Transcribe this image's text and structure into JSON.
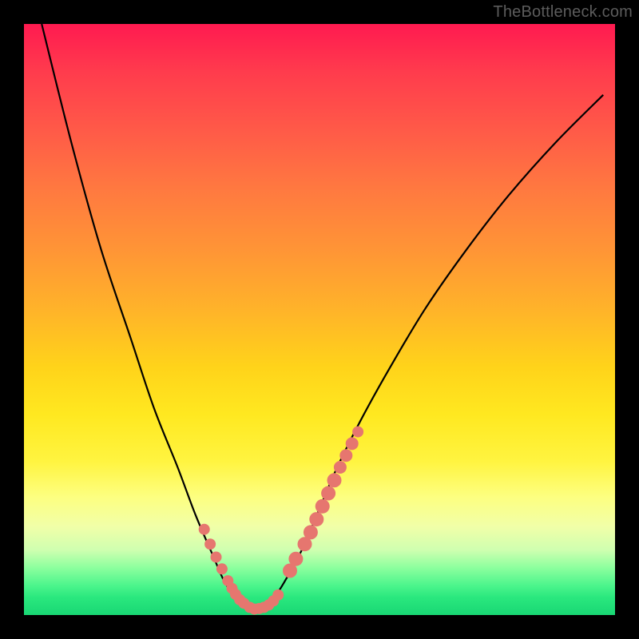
{
  "watermark": "TheBottleneck.com",
  "colors": {
    "frame": "#000000",
    "curve": "#000000",
    "marker": "#e6766f",
    "gradient_top": "#ff1a50",
    "gradient_bottom": "#19d774"
  },
  "chart_data": {
    "type": "line",
    "title": "",
    "xlabel": "",
    "ylabel": "",
    "xlim": [
      0,
      100
    ],
    "ylim": [
      0,
      100
    ],
    "grid": false,
    "legend": false,
    "series": [
      {
        "name": "main-curve",
        "x": [
          3,
          8,
          13,
          18,
          22,
          26,
          29,
          32,
          34,
          36,
          37.5,
          39,
          40.5,
          42,
          44,
          47,
          50,
          53,
          57,
          62,
          68,
          75,
          82,
          90,
          98
        ],
        "values": [
          100,
          80,
          62,
          47,
          35,
          25,
          17,
          10,
          5.5,
          3,
          1.8,
          1,
          1.3,
          2.5,
          5.5,
          11,
          18,
          25,
          33,
          42,
          52,
          62,
          71,
          80,
          88
        ]
      }
    ],
    "markers": [
      {
        "name": "left-cluster",
        "x": [
          30.5,
          31.5,
          32.5,
          33.5,
          34.5,
          35.2,
          35.8,
          36.5,
          37.2
        ],
        "values": [
          14.5,
          12,
          9.8,
          7.8,
          5.8,
          4.5,
          3.5,
          2.6,
          2.0
        ],
        "size": [
          7,
          7,
          7,
          7,
          7,
          7,
          7,
          7,
          7
        ]
      },
      {
        "name": "valley-cluster",
        "x": [
          38.2,
          39.0,
          39.8,
          40.6,
          41.4,
          42.2,
          43.0
        ],
        "values": [
          1.3,
          1.0,
          1.1,
          1.3,
          1.7,
          2.4,
          3.4
        ],
        "size": [
          7,
          7,
          7,
          7,
          7,
          7,
          7
        ]
      },
      {
        "name": "right-cluster",
        "x": [
          45.0,
          46.0,
          47.5,
          48.5,
          49.5,
          50.5,
          51.5,
          52.5,
          53.5,
          54.5,
          55.5,
          56.5
        ],
        "values": [
          7.5,
          9.5,
          12.0,
          14.0,
          16.2,
          18.4,
          20.6,
          22.8,
          25.0,
          27.0,
          29.0,
          31.0
        ],
        "size": [
          9,
          9,
          9,
          9,
          9,
          9,
          9,
          9,
          8,
          8,
          8,
          7
        ]
      }
    ]
  }
}
